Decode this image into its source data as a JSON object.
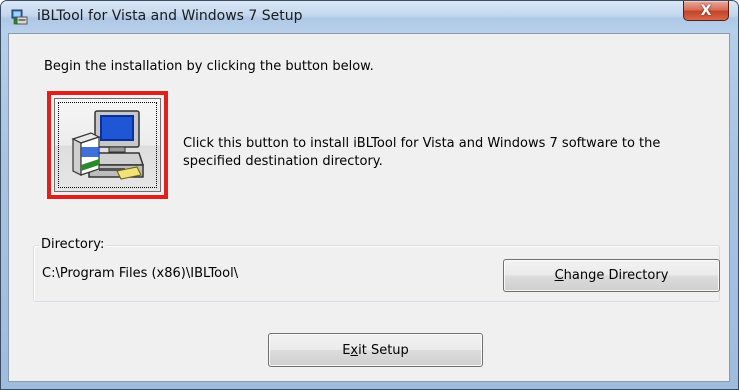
{
  "window": {
    "title": "iBLTool for Vista and Windows 7 Setup",
    "close_glyph": "X"
  },
  "intro": {
    "text": "Begin the installation by clicking the button below."
  },
  "install": {
    "icon": "installer-computer-icon",
    "description": "Click this button to install iBLTool for Vista and Windows 7 software to the specified destination directory."
  },
  "directory": {
    "legend": "Directory:",
    "path": "C:\\Program Files (x86)\\IBLTool\\",
    "change_button": {
      "accel": "C",
      "rest": "hange Directory"
    }
  },
  "exit_button": {
    "pre": "E",
    "accel": "x",
    "post": "it Setup"
  },
  "colors": {
    "highlight_border": "#e0201b",
    "dialog_background": "#f0f0f0"
  }
}
